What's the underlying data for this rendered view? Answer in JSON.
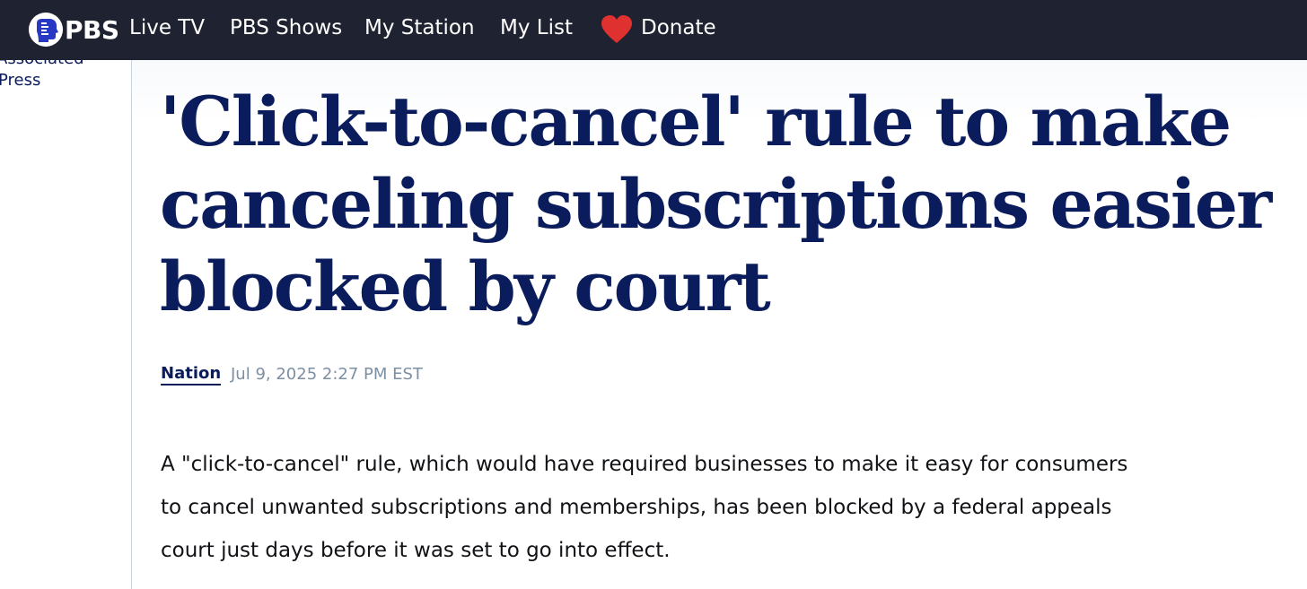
{
  "nav": {
    "logo_text": "PBS",
    "items": [
      {
        "label": "Live TV"
      },
      {
        "label": "PBS Shows"
      },
      {
        "label": "My Station"
      },
      {
        "label": "My List"
      }
    ],
    "donate_label": "Donate",
    "heart_color": "#e03131",
    "background": "#1f2230"
  },
  "sidebar": {
    "author_line1": "Associated",
    "author_line2": "Press"
  },
  "article": {
    "headline": "'Click-to-cancel' rule to make canceling subscriptions easier blocked by court",
    "category": "Nation",
    "timestamp": "Jul 9, 2025 2:27 PM EST",
    "body": "A \"click-to-cancel\" rule, which would have required businesses to make it easy for consumers to cancel unwanted subscriptions and memberships, has been blocked by a federal appeals court just days before it was set to go into effect."
  },
  "colors": {
    "headline": "#0b1c5c",
    "timestamp": "#7d8fa3"
  }
}
